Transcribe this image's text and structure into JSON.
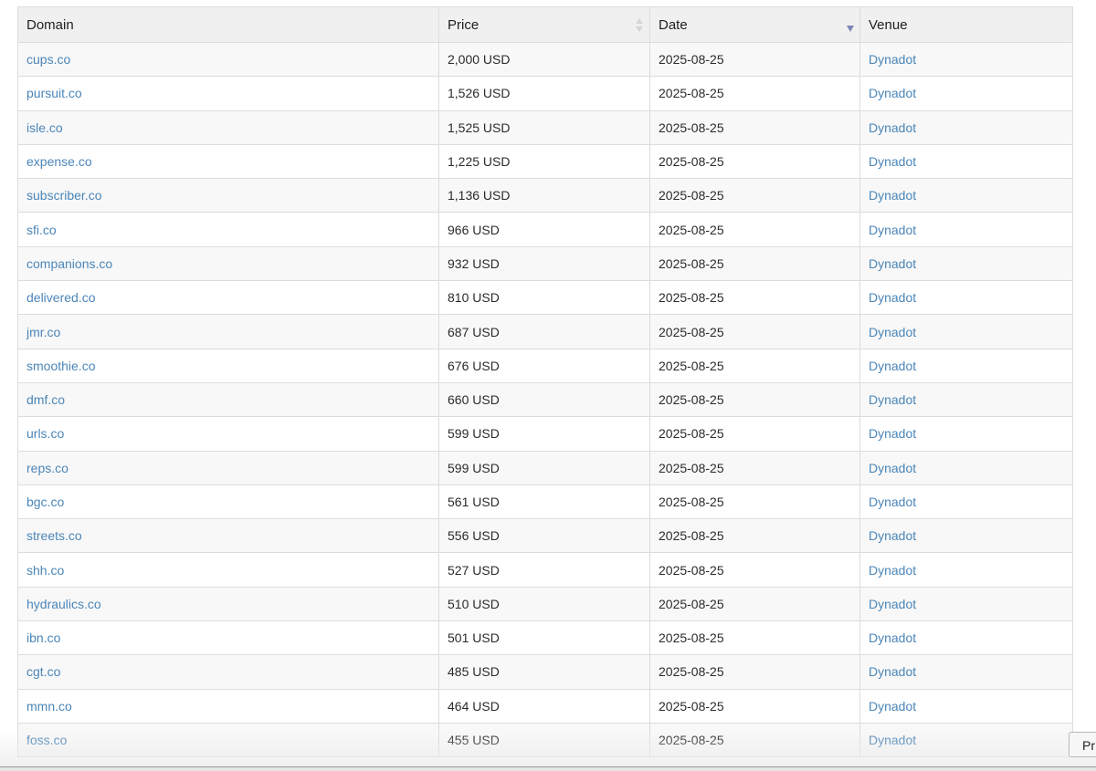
{
  "table": {
    "headers": {
      "domain": "Domain",
      "price": "Price",
      "date": "Date",
      "venue": "Venue"
    },
    "sort": {
      "price": "unsorted",
      "date": "descending"
    },
    "rows": [
      {
        "domain": "cups.co",
        "price": "2,000 USD",
        "date": "2025-08-25",
        "venue": "Dynadot"
      },
      {
        "domain": "pursuit.co",
        "price": "1,526 USD",
        "date": "2025-08-25",
        "venue": "Dynadot"
      },
      {
        "domain": "isle.co",
        "price": "1,525 USD",
        "date": "2025-08-25",
        "venue": "Dynadot"
      },
      {
        "domain": "expense.co",
        "price": "1,225 USD",
        "date": "2025-08-25",
        "venue": "Dynadot"
      },
      {
        "domain": "subscriber.co",
        "price": "1,136 USD",
        "date": "2025-08-25",
        "venue": "Dynadot"
      },
      {
        "domain": "sfi.co",
        "price": "966 USD",
        "date": "2025-08-25",
        "venue": "Dynadot"
      },
      {
        "domain": "companions.co",
        "price": "932 USD",
        "date": "2025-08-25",
        "venue": "Dynadot"
      },
      {
        "domain": "delivered.co",
        "price": "810 USD",
        "date": "2025-08-25",
        "venue": "Dynadot"
      },
      {
        "domain": "jmr.co",
        "price": "687 USD",
        "date": "2025-08-25",
        "venue": "Dynadot"
      },
      {
        "domain": "smoothie.co",
        "price": "676 USD",
        "date": "2025-08-25",
        "venue": "Dynadot"
      },
      {
        "domain": "dmf.co",
        "price": "660 USD",
        "date": "2025-08-25",
        "venue": "Dynadot"
      },
      {
        "domain": "urls.co",
        "price": "599 USD",
        "date": "2025-08-25",
        "venue": "Dynadot"
      },
      {
        "domain": "reps.co",
        "price": "599 USD",
        "date": "2025-08-25",
        "venue": "Dynadot"
      },
      {
        "domain": "bgc.co",
        "price": "561 USD",
        "date": "2025-08-25",
        "venue": "Dynadot"
      },
      {
        "domain": "streets.co",
        "price": "556 USD",
        "date": "2025-08-25",
        "venue": "Dynadot"
      },
      {
        "domain": "shh.co",
        "price": "527 USD",
        "date": "2025-08-25",
        "venue": "Dynadot"
      },
      {
        "domain": "hydraulics.co",
        "price": "510 USD",
        "date": "2025-08-25",
        "venue": "Dynadot"
      },
      {
        "domain": "ibn.co",
        "price": "501 USD",
        "date": "2025-08-25",
        "venue": "Dynadot"
      },
      {
        "domain": "cgt.co",
        "price": "485 USD",
        "date": "2025-08-25",
        "venue": "Dynadot"
      },
      {
        "domain": "mmn.co",
        "price": "464 USD",
        "date": "2025-08-25",
        "venue": "Dynadot"
      },
      {
        "domain": "foss.co",
        "price": "455 USD",
        "date": "2025-08-25",
        "venue": "Dynadot"
      }
    ]
  },
  "pagination": {
    "next_label": "Pr"
  },
  "colors": {
    "link": "#4b86b8",
    "header_bg": "#f0f0f0",
    "sort_active": "#7d86b6"
  }
}
